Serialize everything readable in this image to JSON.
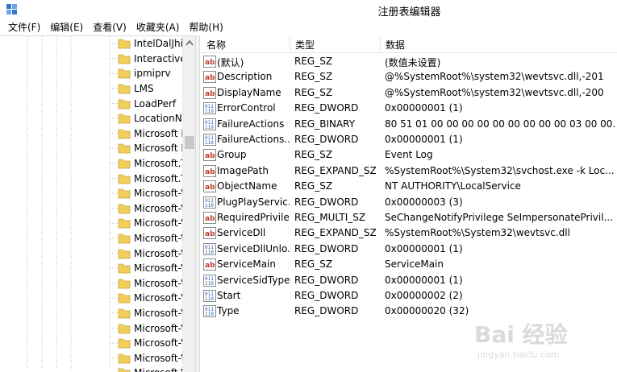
{
  "window": {
    "title": "注册表编辑器",
    "app_icon": "regedit-icon"
  },
  "menu": [
    "文件(F)",
    "编辑(E)",
    "查看(V)",
    "收藏夹(A)",
    "帮助(H)"
  ],
  "tree": {
    "items": [
      "IntelDalJhi",
      "Interactive",
      "ipmiprv",
      "LMS",
      "LoadPerf",
      "LocationNo",
      "Microsoft I",
      "Microsoft I",
      "Microsoft.T",
      "Microsoft.T",
      "Microsoft-V",
      "Microsoft-V",
      "Microsoft-V",
      "Microsoft-V",
      "Microsoft-V",
      "Microsoft-V",
      "Microsoft-V",
      "Microsoft-V",
      "Microsoft-V",
      "Microsoft-V",
      "Microsoft-V",
      "Microsoft-V",
      "Microsoft-V"
    ]
  },
  "list": {
    "headers": {
      "name": "名称",
      "type": "类型",
      "data": "数据"
    },
    "rows": [
      {
        "icon": "string-value-icon",
        "name": "(默认)",
        "type": "REG_SZ",
        "data": "(数值未设置)"
      },
      {
        "icon": "string-value-icon",
        "name": "Description",
        "type": "REG_SZ",
        "data": "@%SystemRoot%\\system32\\wevtsvc.dll,-201"
      },
      {
        "icon": "string-value-icon",
        "name": "DisplayName",
        "type": "REG_SZ",
        "data": "@%SystemRoot%\\system32\\wevtsvc.dll,-200"
      },
      {
        "icon": "binary-value-icon",
        "name": "ErrorControl",
        "type": "REG_DWORD",
        "data": "0x00000001 (1)"
      },
      {
        "icon": "binary-value-icon",
        "name": "FailureActions",
        "type": "REG_BINARY",
        "data": "80 51 01 00 00 00 00 00 00 00 00 00 03 00 00..."
      },
      {
        "icon": "binary-value-icon",
        "name": "FailureActions...",
        "type": "REG_DWORD",
        "data": "0x00000001 (1)"
      },
      {
        "icon": "string-value-icon",
        "name": "Group",
        "type": "REG_SZ",
        "data": "Event Log"
      },
      {
        "icon": "string-value-icon",
        "name": "ImagePath",
        "type": "REG_EXPAND_SZ",
        "data": "%SystemRoot%\\System32\\svchost.exe -k Loc..."
      },
      {
        "icon": "string-value-icon",
        "name": "ObjectName",
        "type": "REG_SZ",
        "data": "NT AUTHORITY\\LocalService"
      },
      {
        "icon": "binary-value-icon",
        "name": "PlugPlayServic...",
        "type": "REG_DWORD",
        "data": "0x00000003 (3)"
      },
      {
        "icon": "string-value-icon",
        "name": "RequiredPrivile...",
        "type": "REG_MULTI_SZ",
        "data": "SeChangeNotifyPrivilege SeImpersonatePrivil..."
      },
      {
        "icon": "string-value-icon",
        "name": "ServiceDll",
        "type": "REG_EXPAND_SZ",
        "data": "%SystemRoot%\\System32\\wevtsvc.dll"
      },
      {
        "icon": "binary-value-icon",
        "name": "ServiceDllUnlo...",
        "type": "REG_DWORD",
        "data": "0x00000001 (1)"
      },
      {
        "icon": "string-value-icon",
        "name": "ServiceMain",
        "type": "REG_SZ",
        "data": "ServiceMain"
      },
      {
        "icon": "binary-value-icon",
        "name": "ServiceSidType",
        "type": "REG_DWORD",
        "data": "0x00000001 (1)"
      },
      {
        "icon": "binary-value-icon",
        "name": "Start",
        "type": "REG_DWORD",
        "data": "0x00000002 (2)"
      },
      {
        "icon": "binary-value-icon",
        "name": "Type",
        "type": "REG_DWORD",
        "data": "0x00000020 (32)"
      }
    ]
  },
  "watermark": {
    "main": "Bai 经验",
    "sub": "jingyan.baidu.com"
  },
  "colors": {
    "folder": "#f2cf5b",
    "string_icon_red": "#c0392b",
    "binary_icon_blue": "#2a5db0"
  }
}
